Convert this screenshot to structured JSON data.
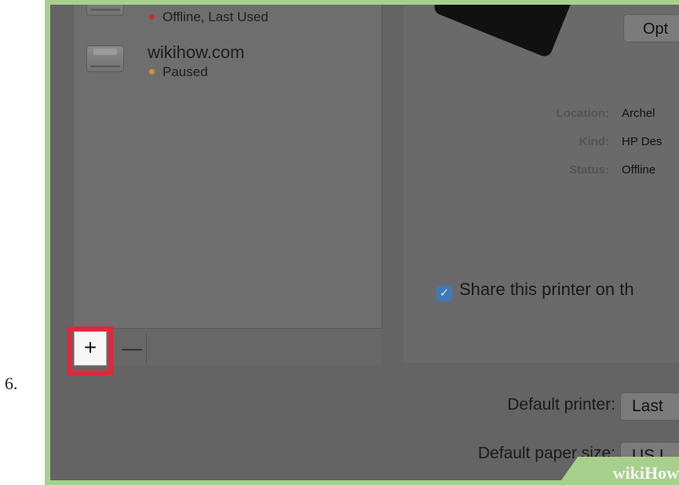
{
  "step_number": "6.",
  "printers": [
    {
      "name": "",
      "status": "Offline, Last Used",
      "status_color": "#c62d2d"
    },
    {
      "name": "wikihow.com",
      "status": "Paused",
      "status_color": "#d9902b"
    }
  ],
  "list_toolbar": {
    "add_label": "+",
    "remove_label": "—"
  },
  "details": {
    "options_label": "Opt",
    "location_label": "Location:",
    "location_value": "Archel",
    "kind_label": "Kind:",
    "kind_value": "HP Des",
    "status_label": "Status:",
    "status_value": "Offline",
    "share_label": "Share this printer on th",
    "share_checked": true
  },
  "preferences": {
    "default_printer_label": "Default printer:",
    "default_printer_value": "Last",
    "default_paper_label": "Default paper size:",
    "default_paper_value": "US L"
  },
  "watermark": {
    "wiki": "wiki",
    "how": "How"
  },
  "colors": {
    "highlight": "#e1273a",
    "frame": "#a8d08d",
    "checkbox": "#3f78b8"
  }
}
